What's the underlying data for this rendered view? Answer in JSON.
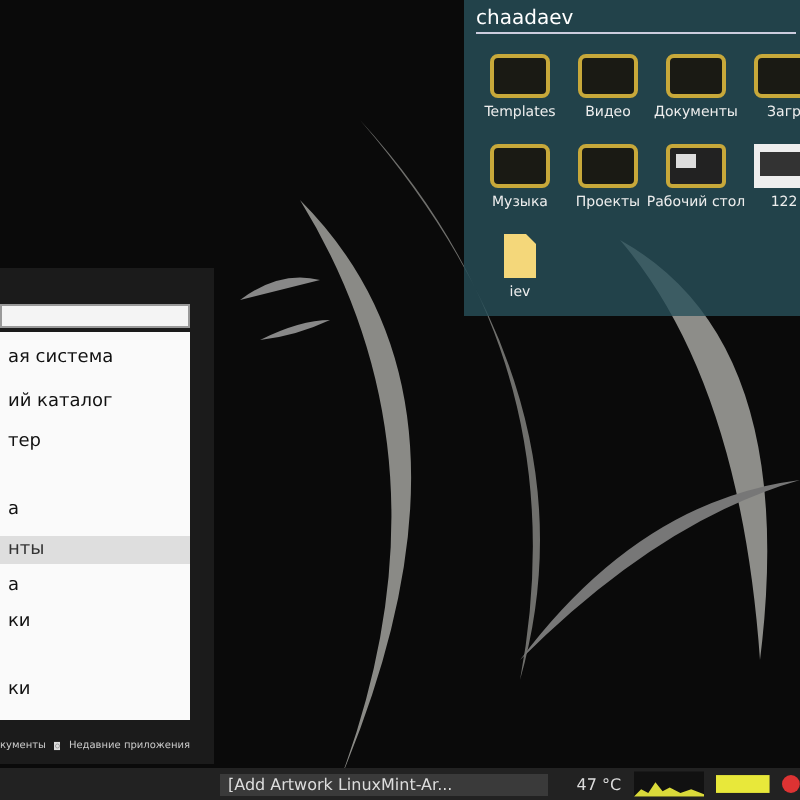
{
  "folder_window": {
    "title": "chaadaev",
    "items": [
      {
        "label": "Templates",
        "kind": "folder"
      },
      {
        "label": "Видео",
        "kind": "folder"
      },
      {
        "label": "Документы",
        "kind": "folder"
      },
      {
        "label": "Загр",
        "kind": "folder"
      },
      {
        "label": "Музыка",
        "kind": "folder"
      },
      {
        "label": "Проекты",
        "kind": "folder"
      },
      {
        "label": "Рабочий стол",
        "kind": "desktop"
      },
      {
        "label": "122",
        "kind": "image"
      },
      {
        "label": "iev",
        "kind": "file"
      }
    ]
  },
  "menu": {
    "items": [
      {
        "label": "ая система",
        "selected": false
      },
      {
        "label": "ий каталог",
        "selected": false
      },
      {
        "label": "тер",
        "selected": false
      },
      {
        "label": "а",
        "selected": false
      },
      {
        "label": "нты",
        "selected": true
      },
      {
        "label": "а",
        "selected": false
      },
      {
        "label": "ки",
        "selected": false
      },
      {
        "label": "ки",
        "selected": false
      }
    ],
    "footer": [
      "кументы",
      "Недавние приложения"
    ]
  },
  "taskbar": {
    "task": "[Add Artwork LinuxMint-Ar...",
    "temperature": "47 °C"
  }
}
